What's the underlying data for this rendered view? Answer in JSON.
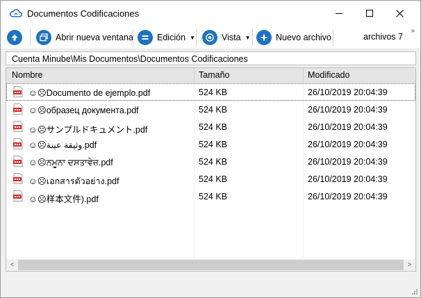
{
  "window": {
    "title": "Documentos Codificaciones"
  },
  "toolbar": {
    "up_label": "",
    "new_window_label": "Abrir nueva ventana",
    "edit_label": "Edición",
    "view_label": "Vista",
    "new_file_label": "Nuevo archivo",
    "file_count": "archivos 7",
    "overflow_glyph": "»"
  },
  "path": {
    "value": "Cuenta Minube\\Mis Documentos\\Documentos Codificaciones"
  },
  "columns": {
    "name": "Nombre",
    "size": "Tamaño",
    "modified": "Modificado"
  },
  "files": [
    {
      "name": "☺☹Documento de ejemplo.pdf",
      "size": "524 KB",
      "modified": "26/10/2019 20:04:39",
      "icon": "pdf-icon"
    },
    {
      "name": "☺☹образец документа.pdf",
      "size": "524 KB",
      "modified": "26/10/2019 20:04:39",
      "icon": "pdf-icon"
    },
    {
      "name": "☺☹サンプルドキュメント.pdf",
      "size": "524 KB",
      "modified": "26/10/2019 20:04:39",
      "icon": "pdf-icon"
    },
    {
      "name": "☺☹وثيقة عينة.pdf",
      "size": "524 KB",
      "modified": "26/10/2019 20:04:39",
      "icon": "pdf-icon"
    },
    {
      "name": "☺☹ਨਮੂਨਾ ਦਸਤਾਵੇਜ਼.pdf",
      "size": "524 KB",
      "modified": "26/10/2019 20:04:39",
      "icon": "pdf-icon"
    },
    {
      "name": "☺☹เอกสารตัวอย่าง.pdf",
      "size": "524 KB",
      "modified": "26/10/2019 20:04:39",
      "icon": "pdf-icon"
    },
    {
      "name": "☺☹样本文件).pdf",
      "size": "524 KB",
      "modified": "26/10/2019 20:04:39",
      "icon": "pdf-icon"
    }
  ],
  "scrollbar": {
    "left_arrow": "<",
    "right_arrow": ">"
  },
  "colors": {
    "accent": "#1e73be",
    "pdf_red": "#d32f2f"
  }
}
